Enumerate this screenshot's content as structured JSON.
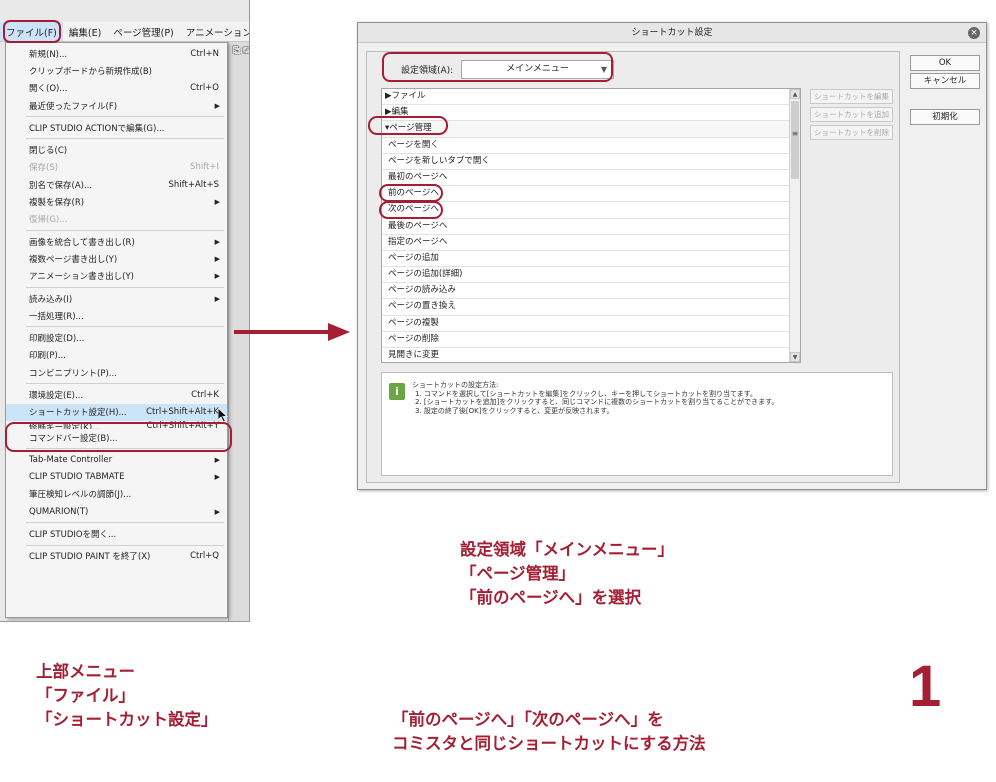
{
  "menubar": {
    "items": [
      "ファイル(F)",
      "編集(E)",
      "ページ管理(P)",
      "アニメーション(A)"
    ]
  },
  "toolbar_glyphs": [
    "⎘",
    "⎚"
  ],
  "file_menu": {
    "items": [
      {
        "label": "新規(N)...",
        "shortcut": "Ctrl+N"
      },
      {
        "label": "クリップボードから新規作成(B)",
        "shortcut": ""
      },
      {
        "label": "開く(O)...",
        "shortcut": "Ctrl+O"
      },
      {
        "label": "最近使ったファイル(F)",
        "shortcut": "",
        "submenu": "▶"
      },
      {
        "sep": true
      },
      {
        "label": "CLIP STUDIO ACTIONで編集(G)...",
        "shortcut": ""
      },
      {
        "sep": true
      },
      {
        "label": "閉じる(C)",
        "shortcut": ""
      },
      {
        "label": "保存(S)",
        "shortcut": "Shift+I",
        "disabled": true
      },
      {
        "label": "別名で保存(A)...",
        "shortcut": "Shift+Alt+S"
      },
      {
        "label": "複製を保存(R)",
        "shortcut": "",
        "submenu": "▶"
      },
      {
        "label": "復帰(G)...",
        "shortcut": "",
        "disabled": true
      },
      {
        "sep": true
      },
      {
        "label": "画像を統合して書き出し(R)",
        "shortcut": "",
        "submenu": "▶"
      },
      {
        "label": "複数ページ書き出し(Y)",
        "shortcut": "",
        "submenu": "▶"
      },
      {
        "label": "アニメーション書き出し(Y)",
        "shortcut": "",
        "submenu": "▶"
      },
      {
        "sep": true
      },
      {
        "label": "読み込み(I)",
        "shortcut": "",
        "submenu": "▶"
      },
      {
        "label": "一括処理(R)...",
        "shortcut": ""
      },
      {
        "sep": true
      },
      {
        "label": "印刷設定(D)...",
        "shortcut": ""
      },
      {
        "label": "印刷(P)...",
        "shortcut": ""
      },
      {
        "label": "コンビニプリント(P)...",
        "shortcut": ""
      },
      {
        "sep": true
      },
      {
        "label": "環境設定(E)...",
        "shortcut": "Ctrl+K"
      },
      {
        "label": "ショートカット設定(H)...",
        "shortcut": "Ctrl+Shift+Alt+K",
        "highlight": true
      },
      {
        "label": "修飾キー設定(K)...",
        "shortcut": "Ctrl+Shift+Alt+Y",
        "cut": true
      },
      {
        "label": "コマンドバー設定(B)...",
        "shortcut": ""
      },
      {
        "sep": true
      },
      {
        "label": "Tab-Mate Controller",
        "shortcut": "",
        "submenu": "▶"
      },
      {
        "label": "CLIP STUDIO TABMATE",
        "shortcut": "",
        "submenu": "▶"
      },
      {
        "label": "筆圧検知レベルの調節(J)...",
        "shortcut": ""
      },
      {
        "label": "QUMARION(T)",
        "shortcut": "",
        "submenu": "▶"
      },
      {
        "sep": true
      },
      {
        "label": "CLIP STUDIOを開く...",
        "shortcut": ""
      },
      {
        "sep": true
      },
      {
        "label": "CLIP STUDIO PAINT を終了(X)",
        "shortcut": "Ctrl+Q"
      }
    ]
  },
  "dialog": {
    "title": "ショートカット設定",
    "close_glyph": "×",
    "area_label": "設定領域(A):",
    "area_value": "メインメニュー",
    "area_caret": "▼",
    "tree_rows": [
      {
        "label": "▶ファイル",
        "level": 0
      },
      {
        "label": "▶編集",
        "level": 0
      },
      {
        "label": "▾ページ管理",
        "level": 0,
        "open": true
      },
      {
        "label": "ページを開く",
        "level": 1
      },
      {
        "label": "ページを新しいタブで開く",
        "level": 1
      },
      {
        "label": "最初のページへ",
        "level": 1
      },
      {
        "label": "前のページへ",
        "level": 1
      },
      {
        "label": "次のページへ",
        "level": 1
      },
      {
        "label": "最後のページへ",
        "level": 1
      },
      {
        "label": "指定のページへ",
        "level": 1
      },
      {
        "label": "ページの追加",
        "level": 1
      },
      {
        "label": "ページの追加(詳細)",
        "level": 1
      },
      {
        "label": "ページの読み込み",
        "level": 1
      },
      {
        "label": "ページの置き換え",
        "level": 1
      },
      {
        "label": "ページの複製",
        "level": 1
      },
      {
        "label": "ページの削除",
        "level": 1
      },
      {
        "label": "見開きに変更",
        "level": 1
      }
    ],
    "scroll_up": "▲",
    "scroll_mid": "≡",
    "scroll_down": "▼",
    "side_buttons": [
      "ショートカットを編集",
      "ショートカットを追加",
      "ショートカットを削除"
    ],
    "ok_label": "OK",
    "cancel_label": "キャンセル",
    "reset_label": "初期化",
    "help_icon": "i",
    "help_lines": [
      "ショートカットの設定方法:",
      "1. コマンドを選択して[ショートカットを編集]をクリックし、キーを押してショートカットを割り当てます。",
      "2. [ショートカットを追加]をクリックすると、同じコマンドに複数のショートカットを割り当てることができます。",
      "3. 設定の終了後[OK]をクリックすると、変更が反映されます。"
    ]
  },
  "captions": {
    "select": [
      "設定領域「メインメニュー」",
      "「ページ管理」",
      "「前のページへ」を選択"
    ],
    "menu": [
      "上部メニュー",
      "「ファイル」",
      "「ショートカット設定」"
    ],
    "method": [
      "「前のページへ」「次のページへ」を",
      "コミスタと同じショートカットにする方法"
    ],
    "step_number": "1"
  },
  "colors": {
    "accent_red": "#a41f33",
    "menu_highlight": "#cce4f7",
    "help_icon_green": "#6aa742"
  }
}
